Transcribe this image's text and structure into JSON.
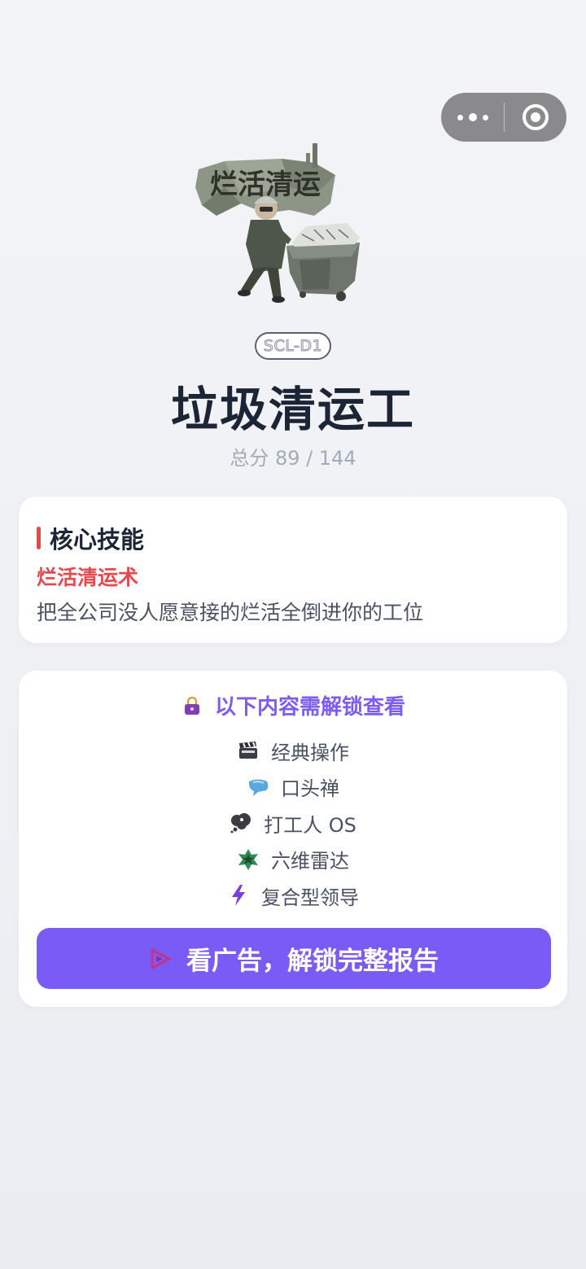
{
  "hero": {
    "image_label": "烂活清运",
    "code": "SCL-D1",
    "title": "垃圾清运工",
    "score": "总分 89 / 144"
  },
  "skill": {
    "heading": "核心技能",
    "name": "烂活清运术",
    "description": "把全公司没人愿意接的烂活全倒进你的工位"
  },
  "locked": {
    "title": "以下内容需解锁查看",
    "items": [
      {
        "icon": "clapperboard-icon",
        "label": "经典操作"
      },
      {
        "icon": "speech-bubble-icon",
        "label": "口头禅"
      },
      {
        "icon": "thought-bubble-icon",
        "label": "打工人 OS"
      },
      {
        "icon": "star-badge-icon",
        "label": "六维雷达"
      },
      {
        "icon": "lightning-icon",
        "label": "复合型领导"
      }
    ],
    "button_label": "看广告，解锁完整报告"
  },
  "colors": {
    "accent_purple": "#7b5bf6",
    "skill_red": "#e5484d",
    "title_dark": "#1c2536"
  }
}
